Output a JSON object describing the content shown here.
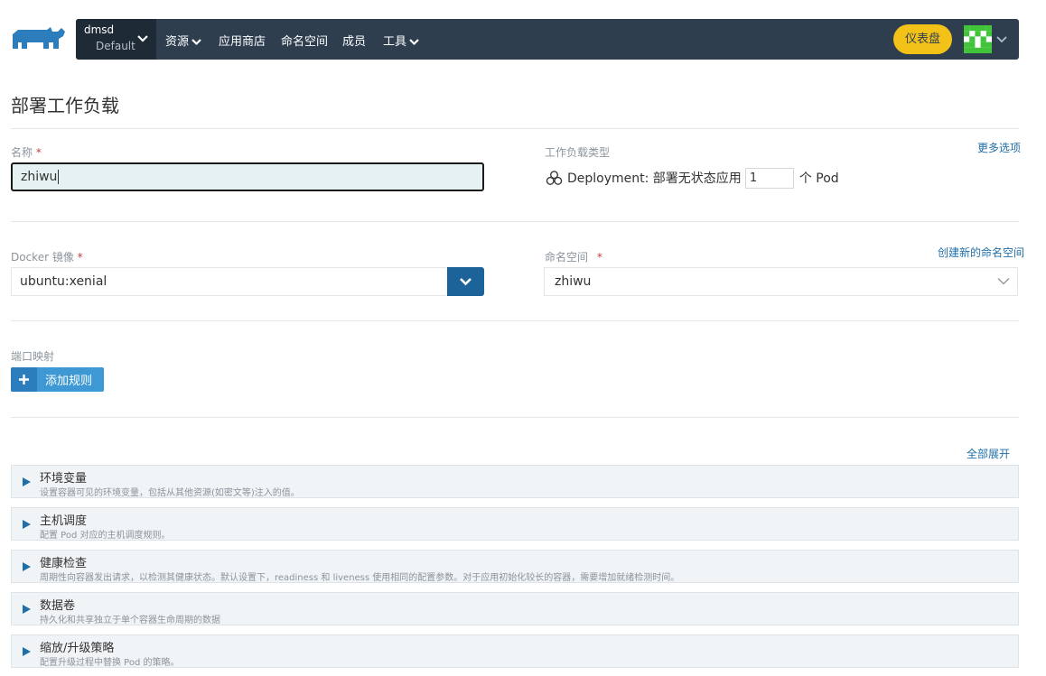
{
  "header": {
    "cluster_name": "dmsd",
    "project_name": "Default",
    "nav": [
      {
        "label": "资源",
        "has_dropdown": true
      },
      {
        "label": "应用商店",
        "has_dropdown": false
      },
      {
        "label": "命名空间",
        "has_dropdown": false
      },
      {
        "label": "成员",
        "has_dropdown": false
      },
      {
        "label": "工具",
        "has_dropdown": true
      }
    ],
    "dashboard_label": "仪表盘",
    "logo_icon": "rancher-cow-icon",
    "avatar_icon": "user-identicon"
  },
  "page": {
    "title": "部署工作负载"
  },
  "form": {
    "name_label": "名称",
    "name_value": "zhiwu",
    "required_mark": "*",
    "workload_type_label": "工作负载类型",
    "more_options": "更多选项",
    "workload_type_text": "Deployment: 部署无状态应用",
    "pod_count": "1",
    "pod_unit": "个 Pod",
    "docker_image_label": "Docker 镜像",
    "docker_image_value": "ubuntu:xenial",
    "namespace_label": "命名空间",
    "create_namespace": "创建新的命名空间",
    "namespace_value": "zhiwu",
    "port_mapping_label": "端口映射",
    "add_rule_label": "添加规则"
  },
  "sections": {
    "expand_all": "全部展开",
    "items": [
      {
        "title": "环境变量",
        "desc": "设置容器可见的环境变量，包括从其他资源(如密文等)注入的值。"
      },
      {
        "title": "主机调度",
        "desc": "配置 Pod 对应的主机调度规则。"
      },
      {
        "title": "健康检查",
        "desc": "周期性向容器发出请求，以检测其健康状态。默认设置下，readiness 和 liveness 使用相同的配置参数。对于应用初始化较长的容器，需要增加就绪检测时间。"
      },
      {
        "title": "数据卷",
        "desc": "持久化和共享独立于单个容器生命周期的数据"
      },
      {
        "title": "缩放/升级策略",
        "desc": "配置升级过程中替换 Pod 的策略。"
      }
    ]
  },
  "colors": {
    "navbar_bg": "#2e3e4f",
    "accent_blue": "#1c6399",
    "dashboard_yellow": "#f3c218",
    "required_red": "#c2413f"
  }
}
